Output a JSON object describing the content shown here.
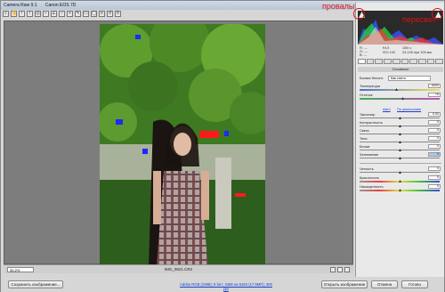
{
  "window": {
    "title_app": "Camera Raw 9.1",
    "title_camera": "Canon EOS 7D"
  },
  "annotations": {
    "clip_shadows": "провалы",
    "clip_highlights": "пересвет"
  },
  "preview": {
    "zoom": "30,2%",
    "filename": "IMG_0821.CR2"
  },
  "footer": {
    "save_button": "Сохранить изображение...",
    "workflow_link": "Adobe RGB (1998); 8 бит; 3456 на 5184 (17,9МП); 300 ppi",
    "open_button": "Открыть изображение",
    "cancel_button": "Отмена",
    "done_button": "Готово"
  },
  "info": {
    "r": "R: ---",
    "g": "G: ---",
    "b": "B: ---",
    "aperture": "f/4,5",
    "shutter": "1/80 с",
    "iso": "ISO 100",
    "lens": "24-105 при 105 мм"
  },
  "panel": {
    "section": "Основные",
    "wb_label": "Баланс белого:",
    "wb_value": "Как снято",
    "temp_label": "Температура",
    "temp_value": "5000",
    "tint_label": "Оттенок",
    "tint_value": "+6",
    "auto_link": "Авто",
    "default_link": "По умолчанию",
    "sliders": [
      {
        "label": "Экспонир.",
        "value": "0,00"
      },
      {
        "label": "Контрастность",
        "value": "0"
      },
      {
        "label": "Света",
        "value": "0"
      },
      {
        "label": "Тени",
        "value": "0"
      },
      {
        "label": "Белые",
        "value": "0"
      },
      {
        "label": "Затемнение",
        "value": "0"
      }
    ],
    "presence": [
      {
        "label": "Четкость",
        "value": "0"
      },
      {
        "label": "Красочность",
        "value": "0"
      },
      {
        "label": "Насыщенность",
        "value": "0"
      }
    ]
  },
  "colors": {
    "clip_warning": "#d11111",
    "shadow_clip": "#1a2bff",
    "highlight_clip": "#ff1a1a"
  }
}
